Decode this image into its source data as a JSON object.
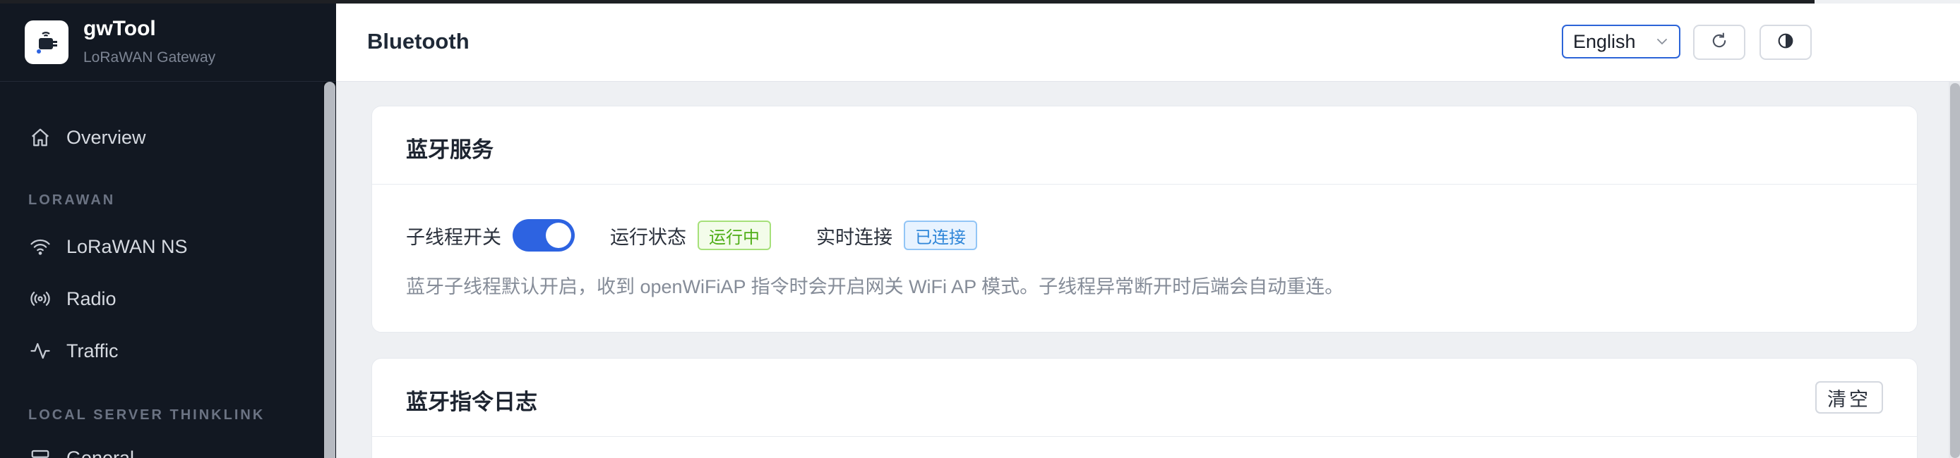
{
  "app": {
    "title": "gwTool",
    "subtitle": "LoRaWAN Gateway"
  },
  "sidebar": {
    "items": [
      {
        "label": "Overview",
        "icon": "home-icon"
      },
      {
        "section": "LORAWAN"
      },
      {
        "label": "LoRaWAN NS",
        "icon": "wifi-icon"
      },
      {
        "label": "Radio",
        "icon": "radio-icon"
      },
      {
        "label": "Traffic",
        "icon": "activity-icon"
      },
      {
        "section": "LOCAL SERVER THINKLINK"
      },
      {
        "label": "General",
        "icon": "server-icon"
      }
    ]
  },
  "header": {
    "title": "Bluetooth",
    "language": "English",
    "refresh_icon": "refresh-icon",
    "theme_icon": "contrast-icon"
  },
  "service_card": {
    "title": "蓝牙服务",
    "switch_label": "子线程开关",
    "switch_on": true,
    "status_label": "运行状态",
    "status_value": "运行中",
    "connection_label": "实时连接",
    "connection_value": "已连接",
    "description": "蓝牙子线程默认开启，收到 openWiFiAP 指令时会开启网关 WiFi AP 模式。子线程异常断开时后端会自动重连。"
  },
  "log_card": {
    "title": "蓝牙指令日志",
    "clear_label": "清空"
  },
  "colors": {
    "sidebar_bg": "#121822",
    "accent": "#2d63e1",
    "status_green": "#4fae18",
    "status_blue": "#2f86d8"
  }
}
